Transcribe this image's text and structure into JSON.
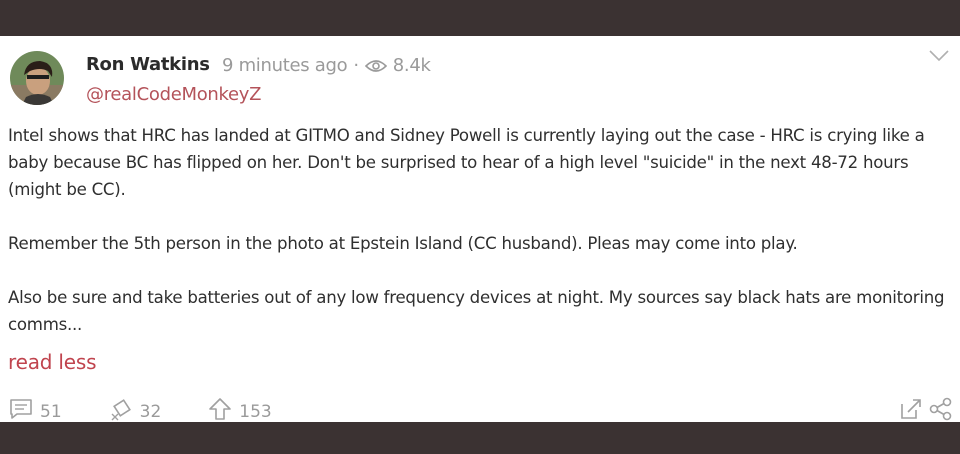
{
  "post": {
    "author_name": "Ron Watkins",
    "time": "9 minutes ago",
    "separator": "·",
    "views": "8.4k",
    "handle": "@realCodeMonkeyZ",
    "paragraphs": [
      "Intel shows that HRC has landed at GITMO and Sidney Powell is currently laying out the case - HRC is crying like a baby because BC has flipped on her. Don't be surprised to hear of a high level \"suicide\" in the next 48-72 hours (might be CC).",
      "Remember the 5th person in the photo at Epstein Island (CC husband). Pleas may come into play.",
      "Also be sure and take batteries out of any low frequency devices at night. My sources say black hats are monitoring comms..."
    ],
    "read_less": "read less",
    "comments": "51",
    "reposts": "32",
    "upvotes": "153"
  },
  "icons": {
    "views": "eye-icon",
    "menu": "chevron-down-icon",
    "comments": "comment-icon",
    "reposts": "repost-icon",
    "upvotes": "upvote-icon",
    "open": "external-link-icon",
    "share": "share-icon"
  },
  "colors": {
    "page_background": "#3b3232",
    "card_background": "#ffffff",
    "handle": "#b4535a",
    "read_less": "#c0444e",
    "muted": "#9a9a9a"
  }
}
